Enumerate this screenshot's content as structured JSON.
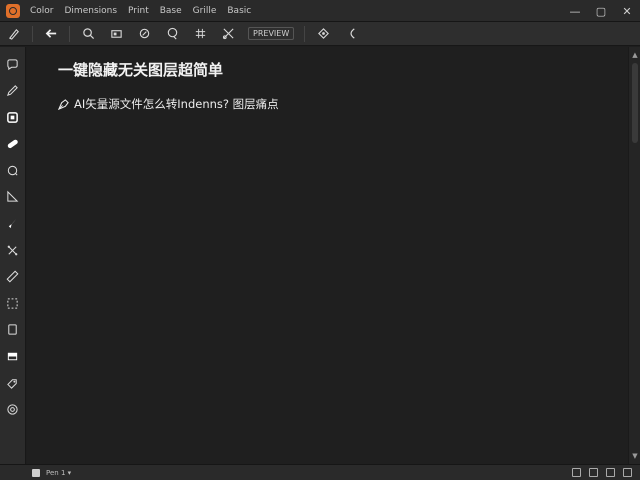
{
  "menubar": {
    "items": [
      "Color",
      "Dimensions",
      "Print",
      "Base",
      "Grille",
      "Basic"
    ],
    "controls": {
      "minimize": "—",
      "maximize": "▢",
      "close": "✕"
    }
  },
  "toolbar": {
    "tools": [
      "pen-tool-icon",
      "back-arrow-icon",
      "search-icon",
      "frame-icon",
      "rotate-icon",
      "lasso-icon",
      "grid-icon",
      "cut-icon",
      "shape-icon",
      "arc-icon"
    ],
    "label_button": "PREVIEW"
  },
  "tools_panel": {
    "items": [
      "chat-icon",
      "pencil-icon",
      "square-tool-icon",
      "bandage-icon",
      "speech-bubble-icon",
      "angle-icon",
      "brush-icon",
      "transform-icon",
      "ruler-icon",
      "select-icon",
      "rectangle-icon",
      "image-icon",
      "tag-icon",
      "settings-icon"
    ]
  },
  "canvas": {
    "heading": "一键隐藏无关图层超简单",
    "subline": "AI矢量源文件怎么转Indenns? 图层痛点"
  },
  "statusbar": {
    "left_text": "Pen 1 ▾"
  },
  "colors": {
    "background": "#1f1f1f",
    "panel": "#2c2c2c",
    "accent": "#e0702a",
    "text": "#f2f2f2"
  }
}
